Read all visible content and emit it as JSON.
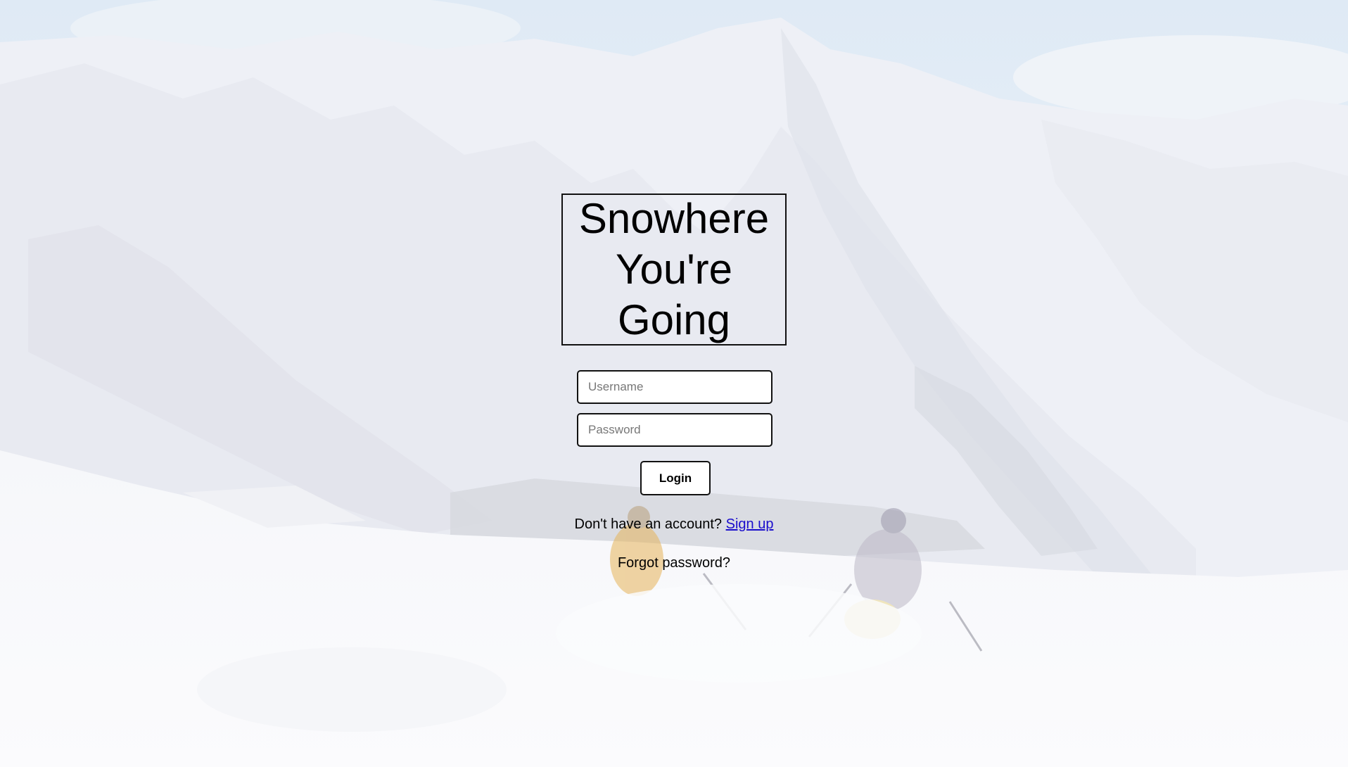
{
  "hero": {
    "title_line1": "Snowhere",
    "title_line2": "You're",
    "title_line3": "Going"
  },
  "login_form": {
    "username_placeholder": "Username",
    "username_value": "",
    "password_placeholder": "Password",
    "password_value": "",
    "login_label": "Login"
  },
  "footer_links": {
    "signup_prompt": "Don't have an account?",
    "signup_link": "Sign up",
    "forgot_password": "Forgot password?"
  },
  "colors": {
    "text": "#000000",
    "link": "#1a0dcc",
    "border": "#111111"
  }
}
